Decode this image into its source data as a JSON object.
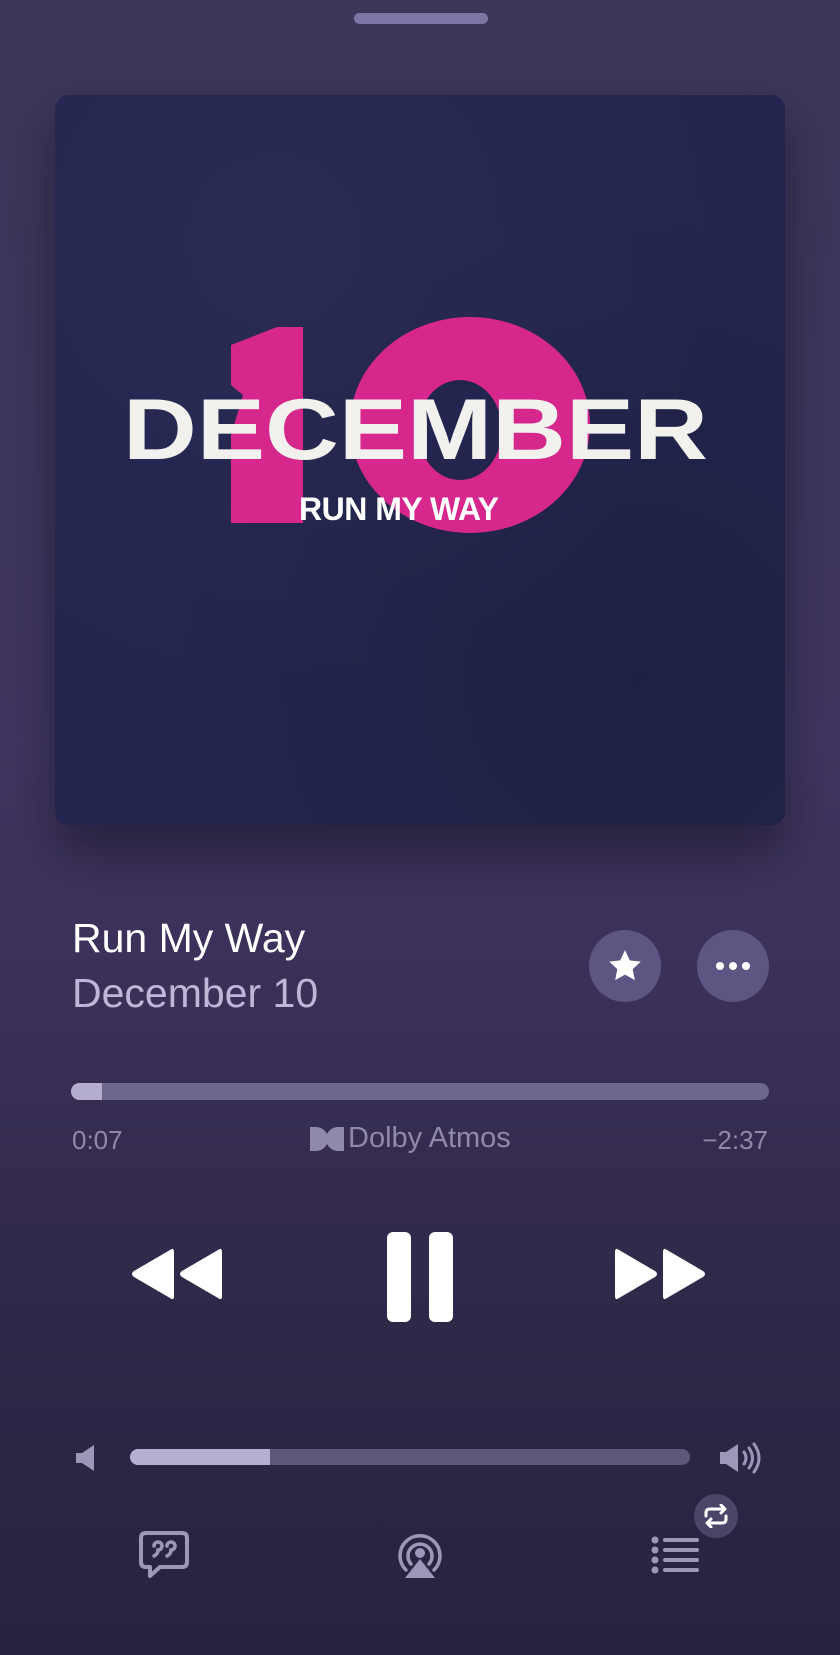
{
  "now_playing": {
    "album_art": {
      "wordmark": "DECEMBER",
      "number": "10",
      "subtitle": "RUN MY WAY"
    },
    "track_title": "Run My Way",
    "artist": "December 10",
    "elapsed": "0:07",
    "remaining": "−2:37",
    "progress_fraction": 0.045,
    "audio_badge": "Dolby Atmos",
    "volume_fraction": 0.25
  },
  "colors": {
    "background": "#3c3658",
    "art_background": "#23254f",
    "art_accent": "#d6278d",
    "secondary_text": "#c2b6d8",
    "muted_text": "#8f89ab"
  },
  "icons": {
    "favorite": "star-icon",
    "more": "more-icon",
    "rewind": "rewind-icon",
    "pause": "pause-icon",
    "forward": "forward-icon",
    "volume_low": "speaker-low-icon",
    "volume_high": "speaker-high-icon",
    "lyrics": "lyrics-icon",
    "airplay": "airplay-icon",
    "queue": "queue-icon",
    "repeat": "repeat-icon"
  }
}
